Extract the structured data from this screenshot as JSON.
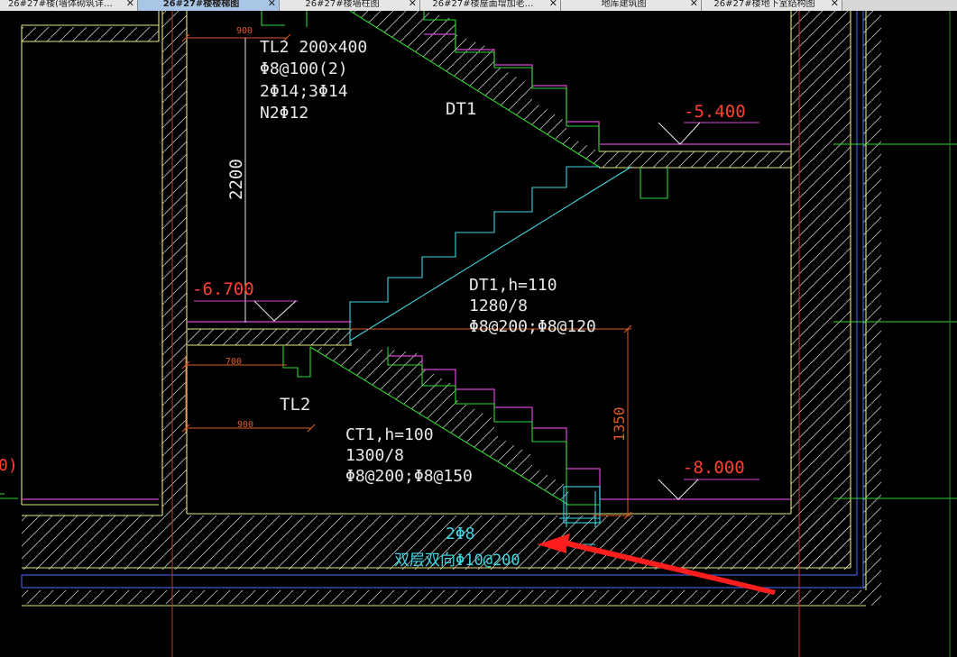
{
  "tabs": [
    {
      "label": "26#27#楼(墙体砌筑详…",
      "active": false
    },
    {
      "label": "26#27#楼楼梯图",
      "active": true
    },
    {
      "label": "26#27#楼墙柱图",
      "active": false
    },
    {
      "label": "26#27#楼屋面增加老…",
      "active": false
    },
    {
      "label": "地库建筑图",
      "active": false
    },
    {
      "label": "26#27#楼地下室结构图",
      "active": false
    }
  ],
  "tab_close_glyph": "✕",
  "drawing": {
    "beam_top": {
      "name": "TL2 200x400",
      "stirrup": "Φ8@100(2)",
      "main_bars": "2Φ14;3Φ14",
      "side_bars": "N2Φ12"
    },
    "stair_upper": {
      "name": "DT1",
      "spec": "DT1,h=110",
      "steps": "1280/8",
      "rebar": "Φ8@200;Φ8@120"
    },
    "stair_lower": {
      "spec": "CT1,h=100",
      "steps": "1300/8",
      "rebar": "Φ8@200;Φ8@150"
    },
    "beam_label": "TL2",
    "elevations": {
      "top": "-5.400",
      "middle": "-6.700",
      "bottom": "-8.000"
    },
    "dimensions": {
      "top_width": "900",
      "height_upper": "2200",
      "landing_700": "700",
      "landing_900": "900",
      "height_lower": "1350"
    },
    "slab_rebar": {
      "bars": "2Φ8",
      "mesh": "双层双向Φ10@200"
    },
    "left_clip": "0)"
  },
  "colors": {
    "wall": "#e5e57a",
    "hatch": "#d8d8d8",
    "stair": "#2fd62f",
    "cyan": "#3fd3e0",
    "magenta": "#d447d4",
    "red": "#e05a2a",
    "elev_red": "#ff4030",
    "arrow": "#ff1e1e",
    "text": "#e8e8e8"
  }
}
